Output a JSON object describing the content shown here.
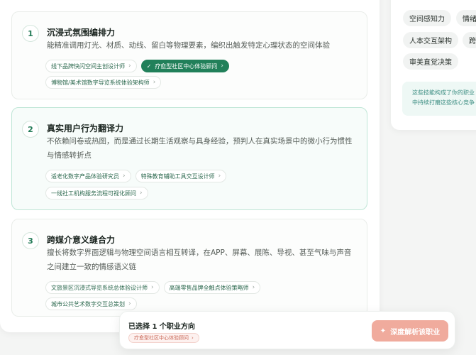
{
  "cards": [
    {
      "num": "1",
      "title": "沉浸式氛围编排力",
      "desc": "能精准调用灯光、材质、动线、留白等物理要素，编织出触发特定心理状态的空间体验",
      "tags": [
        {
          "label": "线下品牌快闪空间主创设计师",
          "selected": false
        },
        {
          "label": "疗愈型社区中心体验顾问",
          "selected": true
        },
        {
          "label": "博物馆/美术馆数字导览系统体验架构师",
          "selected": false
        }
      ]
    },
    {
      "num": "2",
      "title": "真实用户行为翻译力",
      "desc": "不依赖问卷或热图，而是通过长期生活观察与具身经验，预判人在真实场景中的微小行为惯性与情感转折点",
      "tags": [
        {
          "label": "适老化数字产品体验研究员",
          "selected": false
        },
        {
          "label": "特殊教育辅助工具交互设计师",
          "selected": false
        },
        {
          "label": "一线社工机构服务流程可视化顾问",
          "selected": false
        }
      ]
    },
    {
      "num": "3",
      "title": "跨媒介意义缝合力",
      "desc": "擅长将数字界面逻辑与物理空间语言相互转译，在APP、屏幕、展陈、导视、甚至气味与声音之间建立一致的情感语义链",
      "tags": [
        {
          "label": "文旅景区沉浸式导览系统总体验设计师",
          "selected": false
        },
        {
          "label": "高端零售品牌全触点体验策略师",
          "selected": false
        },
        {
          "label": "城市公共艺术数字交互总策划",
          "selected": false
        }
      ]
    }
  ],
  "skills": [
    "空间感知力",
    "情绪",
    "人本交互架构",
    "跨",
    "审美直觉决策"
  ],
  "note": {
    "line1": "这些技能构成了你的职业",
    "line2": "中持续打磨这些核心竞争"
  },
  "bottom": {
    "count_label": "已选择 1 个职业方向",
    "chip_label": "疗愈型社区中心体验顾问",
    "analyze_label": "深度解析该职业"
  },
  "colors": {
    "accent": "#21805a",
    "cta": "#f0ab9d"
  },
  "icons": {
    "chevron": "chevron-right-icon",
    "check": "check-icon",
    "sparkle": "sparkle-icon"
  }
}
